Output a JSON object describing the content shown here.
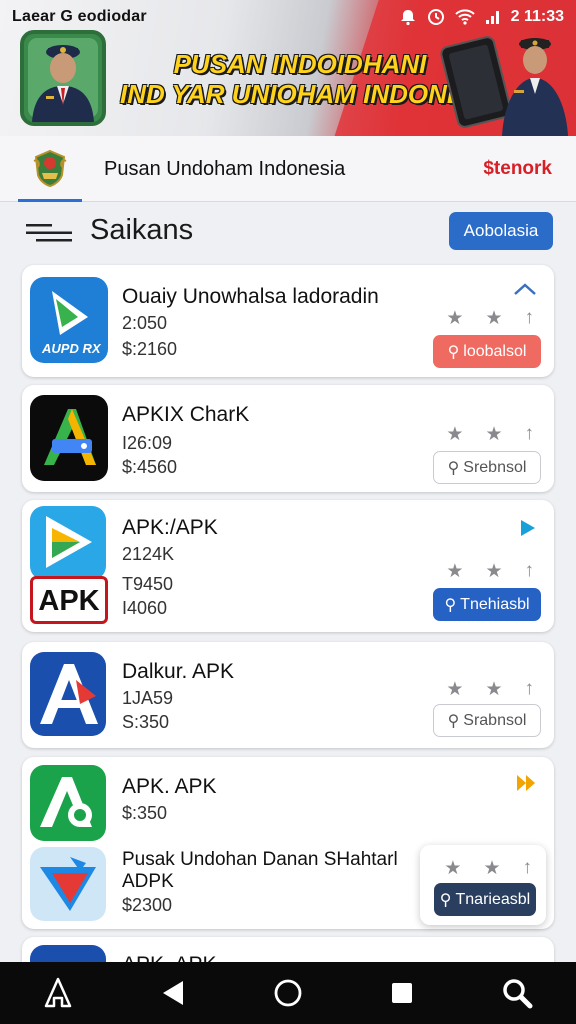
{
  "status_bar": {
    "carrier": "Laear G eodiodar",
    "time": "2 11:33"
  },
  "banner": {
    "headline_line1": "PUSAN INDOIDHANI",
    "headline_line2": "IND YAR UNIOHAM INDONESIA"
  },
  "app_header": {
    "title": "Pusan Undoham Indonesia",
    "network_label": "$tenork"
  },
  "section": {
    "title": "Saikans",
    "action_label": "Aobolasia"
  },
  "apps": [
    {
      "name": "Ouaiy Unowhalsa ladoradin",
      "line1": "2:050",
      "line2": "$:2160",
      "button": "loobalsol",
      "button_style": "red",
      "corner": "chevron-up-icon"
    },
    {
      "name": "APKIX CharK",
      "line1": "I26:09",
      "line2": "$:4560",
      "button": "Srebnsol",
      "button_style": "outline",
      "corner": ""
    },
    {
      "name": "APK:/APK",
      "line1": "2124K",
      "line2": "T9450",
      "line3": "I4060",
      "button": "Tnehiasbl",
      "button_style": "blue",
      "corner": "play-arrow-icon"
    },
    {
      "name": "Dalkur. APK",
      "line1": "1JA59",
      "line2": "S:350",
      "button": "Srabnsol",
      "button_style": "outline",
      "corner": ""
    },
    {
      "name": "APK. APK",
      "line1": "$:350",
      "sub_name": "Pusak Undohan Danan SHahtarl",
      "sub_name2": "ADPK",
      "sub_price": "$2300",
      "button": "Tnarieasbl",
      "button_style": "navy",
      "corner": "fast-forward-icon"
    },
    {
      "name": "APK. APK"
    }
  ],
  "colors": {
    "accent_blue": "#2b6cc9",
    "accent_red": "#d71f26",
    "banner_yellow": "#ffd21c"
  }
}
